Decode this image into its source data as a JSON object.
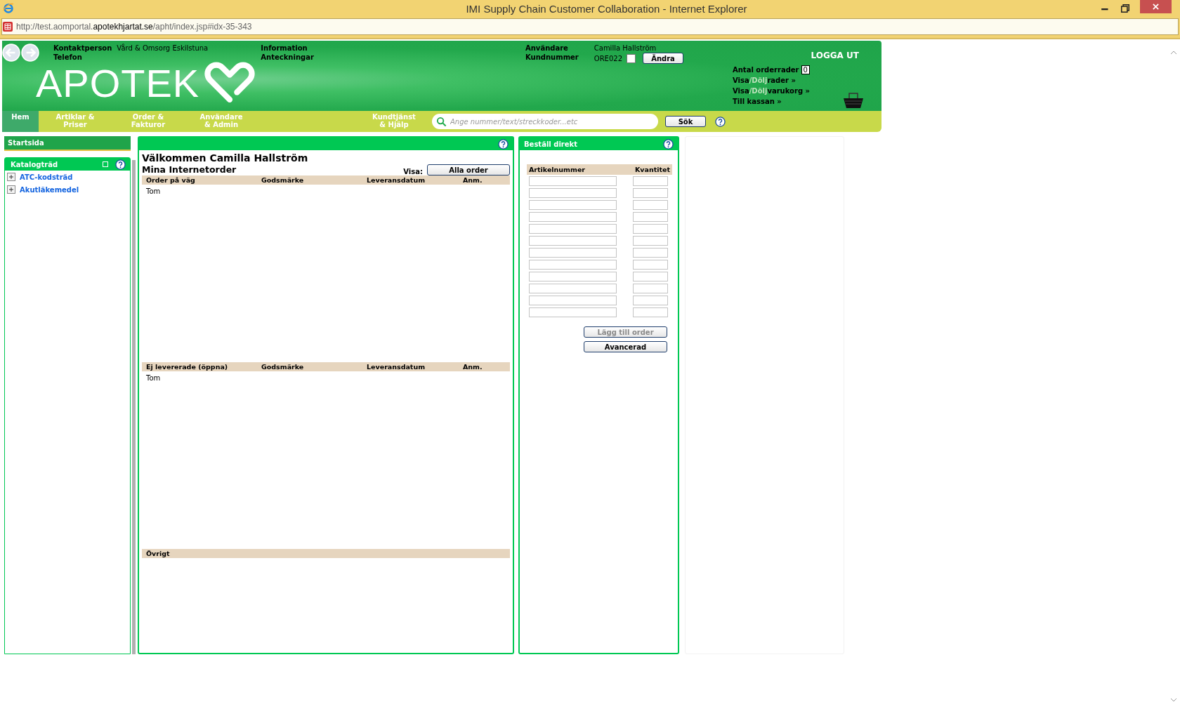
{
  "window": {
    "title": "IMI Supply Chain Customer Collaboration - Internet Explorer"
  },
  "address_bar": {
    "prefix": "http://test.aomportal.",
    "domain": "apotekhjartat.se",
    "path": "/apht/index.jsp#idx-35-343"
  },
  "header": {
    "contact_labels": [
      "Kontaktperson",
      "Telefon"
    ],
    "contact_value": "Vård & Omsorg Eskilstuna",
    "info_labels": [
      "Information",
      "Anteckningar"
    ],
    "logo": "APOTEK",
    "user_labels": [
      "Användare",
      "Kundnummer"
    ],
    "user_name": "Camilla Hallström",
    "customer_number": "ORE022",
    "customer_checkbox": {
      "checked": false
    },
    "change_button": "Ändra",
    "logout": "LOGGA UT",
    "order_rows_label": "Antal orderrader",
    "order_rows_count": "0",
    "links": [
      {
        "show": "Visa",
        "hide": "/Dölj",
        "rest": "rader »"
      },
      {
        "show": "Visa",
        "hide": "/Dölj",
        "rest": "varukorg »"
      },
      {
        "rest": "Till kassan »"
      }
    ]
  },
  "nav": {
    "tabs": [
      {
        "label": "Hem",
        "selected": true
      },
      {
        "label": "Artiklar & Priser",
        "selected": false
      },
      {
        "label": "Order & Fakturor",
        "selected": false
      },
      {
        "label": "Användare & Admin",
        "selected": false
      },
      {
        "label": "Kundtjänst & Hjälp",
        "selected": false
      }
    ],
    "search": {
      "placeholder": "Ange nummer/text/streckkoder...etc"
    },
    "search_button": "Sök"
  },
  "sidebar": {
    "start": "Startsida",
    "catalog_title": "Katalogträd",
    "items": [
      {
        "label": "ATC-kodsträd",
        "expanded": false
      },
      {
        "label": "Akutläkemedel",
        "expanded": false
      }
    ]
  },
  "main": {
    "welcome": "Välkommen Camilla Hallström",
    "subtitle": "Mina Internetorder",
    "show_label": "Visa:",
    "show_button": "Alla order",
    "sections": [
      {
        "columns": [
          "Order på väg",
          "Godsmärke",
          "Leveransdatum",
          "Anm."
        ],
        "rows": [
          "Tom"
        ]
      },
      {
        "columns": [
          "Ej levererade (öppna)",
          "Godsmärke",
          "Leveransdatum",
          "Anm."
        ],
        "rows": [
          "Tom"
        ]
      },
      {
        "columns": [
          "Övrigt"
        ]
      }
    ]
  },
  "order_direct": {
    "title": "Beställ direkt",
    "columns": [
      "Artikelnummer",
      "Kvantitet"
    ],
    "buttons": [
      {
        "label": "Lägg till order",
        "disabled": true
      },
      {
        "label": "Avancerad",
        "disabled": false
      }
    ]
  }
}
